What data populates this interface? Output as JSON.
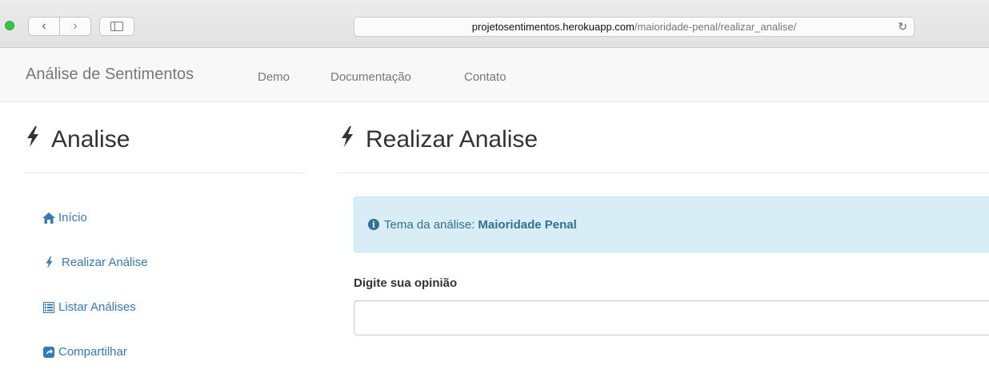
{
  "browser": {
    "url_domain": "projetosentimentos.herokuapp.com",
    "url_path": "/maioridade-penal/realizar_analise/",
    "back_glyph": "‹",
    "forward_glyph": "›",
    "reload_glyph": "↻"
  },
  "navbar": {
    "brand": "Análise de Sentimentos",
    "links": [
      "Demo",
      "Documentação",
      "Contato"
    ]
  },
  "sidebar": {
    "title": "Analise",
    "items": [
      {
        "label": "Início",
        "icon": "home-icon"
      },
      {
        "label": "Realizar Análise",
        "icon": "bolt-icon"
      },
      {
        "label": "Listar Análises",
        "icon": "list-icon"
      },
      {
        "label": "Compartilhar",
        "icon": "share-icon"
      }
    ]
  },
  "main": {
    "title": "Realizar Analise",
    "alert": {
      "prefix": "Tema da análise:",
      "topic": "Maioridade Penal"
    },
    "form": {
      "label": "Digite sua opinião",
      "value": "",
      "placeholder": ""
    }
  },
  "colors": {
    "link": "#337ab7",
    "alert_bg": "#d9edf7",
    "alert_text": "#31708f",
    "navbar_bg": "#f8f8f8"
  }
}
